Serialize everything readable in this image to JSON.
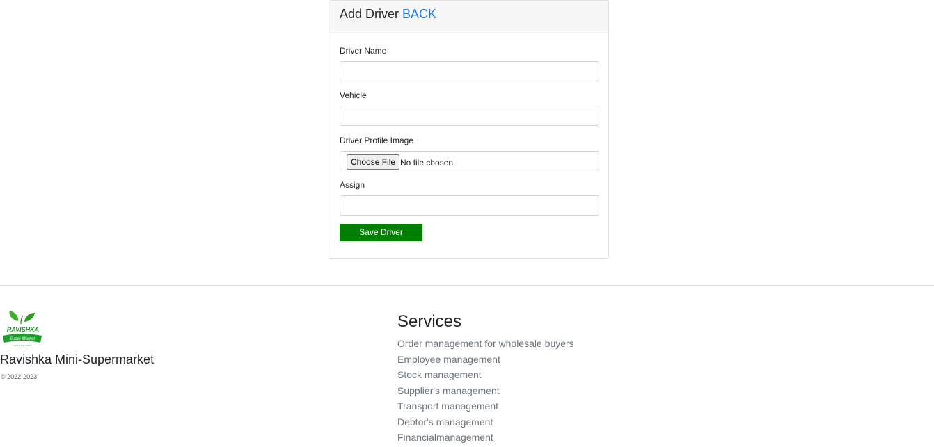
{
  "form": {
    "title": "Add Driver",
    "back_label": "BACK",
    "fields": {
      "driver_name_label": "Driver Name",
      "driver_name_value": "",
      "vehicle_label": "Vehicle",
      "vehicle_value": "",
      "profile_image_label": "Driver Profile Image",
      "file_button_label": "Choose File",
      "file_status": "No file chosen",
      "assign_label": "Assign",
      "assign_value": ""
    },
    "submit_label": "Save Driver"
  },
  "footer": {
    "logo": {
      "icon": "leaf-logo-icon",
      "top_text": "RAVISHKA",
      "ribbon_text": "Super Market",
      "tagline": "Natural Super Mart"
    },
    "brand_name": "Ravishka Mini-Supermarket",
    "copyright": "© 2022-2023",
    "services_title": "Services",
    "services": [
      "Order management for wholesale buyers",
      "Employee management",
      "Stock management",
      "Supplier's management",
      "Transport management",
      "Debtor's management",
      "Financialmanagement"
    ]
  },
  "colors": {
    "accent_link": "#1a7ae6",
    "save_button": "#008000",
    "logo_green": "#1e9e2a"
  }
}
